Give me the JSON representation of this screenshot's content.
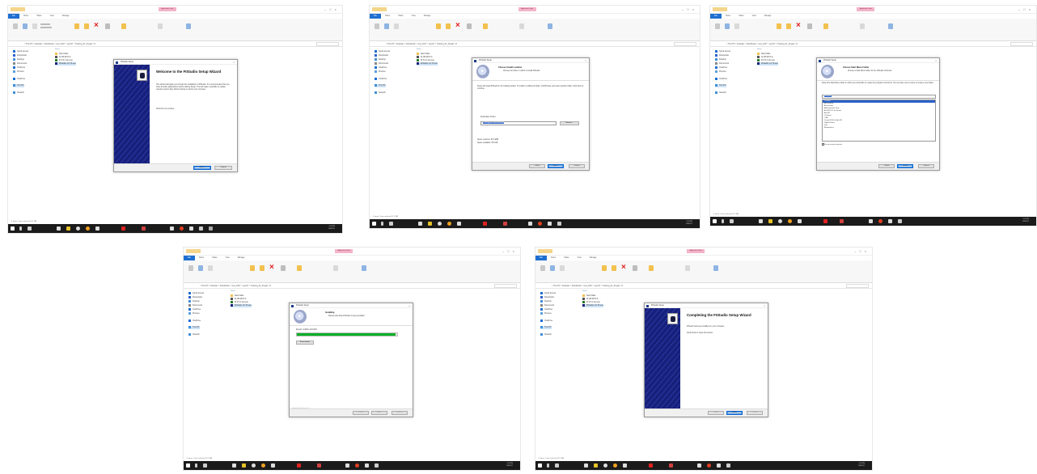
{
  "explorer": {
    "quick_access_label": "Quick access",
    "ribbon_tabs": [
      "File",
      "Home",
      "Share",
      "View",
      "Manage"
    ],
    "context_tab": "Application Tools",
    "breadcrumb": "> This PC > Desktop > FlowStudio > new_2017 > sept17 > Training_01_Fivegit > 8",
    "search_placeholder": "Search 8",
    "nav_items": [
      "Quick access",
      "Downloads",
      "Desktop",
      "Documents",
      "OneDrive",
      "Pictures",
      "OneDrive",
      "This PC",
      "Network"
    ],
    "files_header": "Name",
    "files": [
      "New folder",
      "11-08-2017.ls",
      "FI 5.6.1 win.exe",
      "FIStudio 1.0.73.exe"
    ],
    "status": "4 items   1 item selected 57.4 MB",
    "clock_time": "2:34 PM",
    "clock_date": "8/3/2017"
  },
  "screens": {
    "welcome": {
      "dialog_title": "FIStudio Setup",
      "heading": "Welcome to the FIStudio Setup Wizard",
      "body": "This wizard will guide you through the installation of FIStudio. It is recommended that you close all other applications before starting Setup. This will make it possible to update relevant system files without having to reboot your computer.",
      "continue": "Click Next to continue.",
      "next": "Next >",
      "cancel": "Cancel"
    },
    "location": {
      "dialog_title": "FIStudio Setup",
      "heading": "Choose Install Location",
      "subheading": "Choose the folder in which to install FIStudio.",
      "body": "Setup will install FIStudio in the following folder. To install in a different folder, click Browse and select another folder. Click Next to continue.",
      "folder_label": "Destination Folder",
      "folder_value": "C:\\Program Files\\FIStudio",
      "browse": "Browse...",
      "space_required": "Space required: 972.4MB",
      "space_available": "Space available: 56.6GB",
      "back": "< Back",
      "next": "Next >",
      "cancel": "Cancel"
    },
    "startmenu": {
      "dialog_title": "FIStudio Setup",
      "heading": "Choose Start Menu Folder",
      "subheading": "Choose a Start Menu folder for the FIStudio shortcuts.",
      "body": "Select the Start Menu folder in which you would like to create the program's shortcuts. You can also enter a name to create a new folder.",
      "folder_value": "FIStudio",
      "list": [
        "FIStudio",
        "Accessibility",
        "Accessories",
        "Administrative Tools",
        "ArcGIS 10.5 for Server",
        "ArcGIS",
        "CCleaner",
        "CSA",
        "Crystal 2016 for ArcGIS",
        "Digital Photos",
        "Intel",
        "Maintenance"
      ],
      "dont_create": "Do not create shortcuts",
      "back": "< Back",
      "install": "Install",
      "cancel": "Cancel"
    },
    "installing": {
      "dialog_title": "FIStudio Setup",
      "heading": "Installing",
      "subheading": "Please wait while FIStudio is being installed.",
      "detail": "Extract: GdiPlus.dll 100%",
      "progress": 0.98,
      "show_details": "Show details",
      "nsis": "Nullsoft Install System v3.0",
      "back": "< Back",
      "next": "Next >",
      "cancel": "Cancel"
    },
    "complete": {
      "dialog_title": "FIStudio Setup",
      "heading": "Completing the FIStudio Setup Wizard",
      "body": "FIStudio has been installed on your computer.",
      "finish_hint": "Click Finish to close this wizard.",
      "back": "< Back",
      "finish": "Finish",
      "cancel": "Cancel"
    }
  },
  "colors": {
    "file_tab": "#1f6fd1",
    "banner": "#17207a",
    "progress": "#06b025",
    "taskbar": "#1b1b1b"
  }
}
